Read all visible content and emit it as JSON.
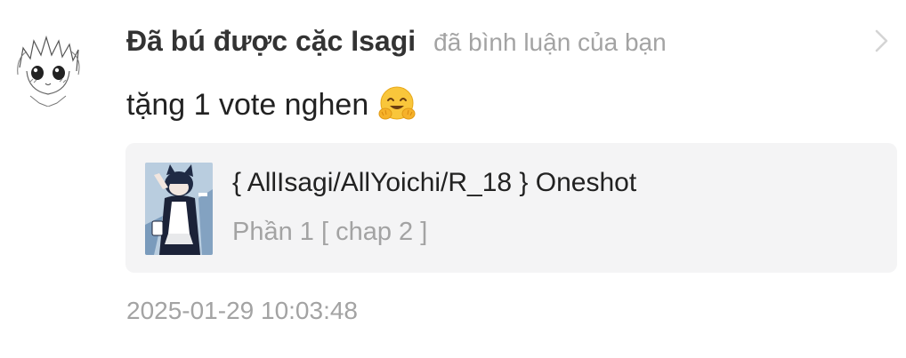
{
  "notification": {
    "username": "Đã bú được cặc Isagi",
    "action": "đã bình luận của bạn",
    "comment_text": "tặng 1 vote nghen",
    "comment_emoji": "hugging-face-emoji",
    "story": {
      "title": "{ AllIsagi/AllYoichi/R_18 } Oneshot",
      "part": "Phần 1 [ chap 2 ]"
    },
    "timestamp": "2025-01-29 10:03:48"
  },
  "icons": {
    "open_detail": "chevron-right-icon"
  },
  "colors": {
    "username": "#333333",
    "secondary_text": "#a3a3a3",
    "card_background": "#f4f4f5",
    "chevron": "#d4d4d4"
  }
}
